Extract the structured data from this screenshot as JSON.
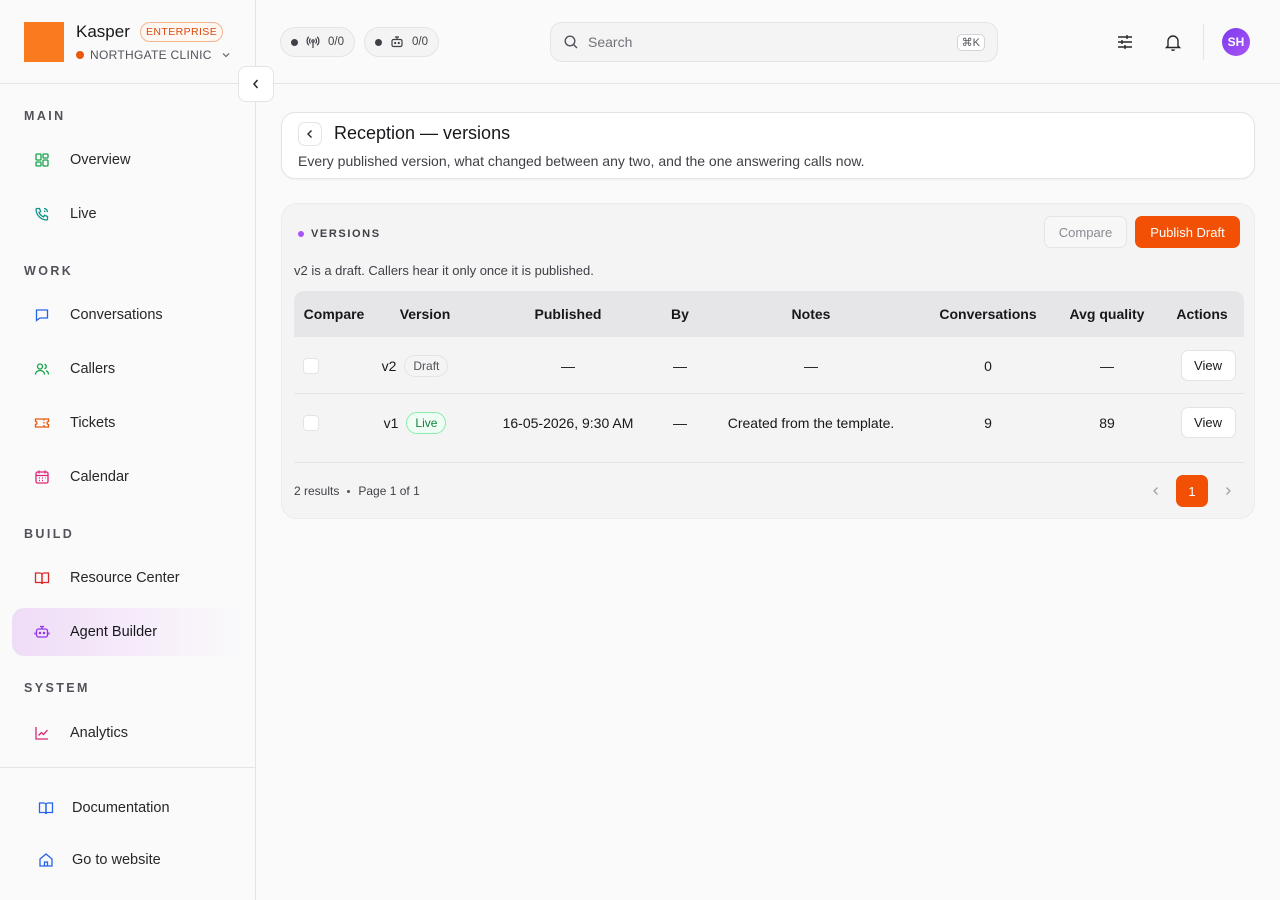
{
  "brand": {
    "name": "Kasper",
    "badge": "ENTERPRISE",
    "org": "NORTHGATE CLINIC"
  },
  "topbar": {
    "pill_calls": "0/0",
    "pill_agents": "0/0",
    "search_placeholder": "Search",
    "search_shortcut": "⌘K",
    "avatar_initials": "SH"
  },
  "sidebar": {
    "sections": {
      "main": "MAIN",
      "work": "WORK",
      "build": "BUILD",
      "system": "SYSTEM"
    },
    "items": {
      "overview": "Overview",
      "live": "Live",
      "conversations": "Conversations",
      "callers": "Callers",
      "tickets": "Tickets",
      "calendar": "Calendar",
      "resource_center": "Resource Center",
      "agent_builder": "Agent Builder",
      "analytics": "Analytics"
    },
    "active": "Agent Builder",
    "bottom": {
      "documentation": "Documentation",
      "website": "Go to website"
    }
  },
  "header": {
    "title": "Reception — versions",
    "subtitle": "Every published version, what changed between any two, and the one answering calls now."
  },
  "versions": {
    "label": "VERSIONS",
    "compare_label": "Compare",
    "publish_label": "Publish Draft",
    "note": "v2 is a draft. Callers hear it only once it is published.",
    "columns": {
      "compare": "Compare",
      "version": "Version",
      "published": "Published",
      "by": "By",
      "notes": "Notes",
      "conversations": "Conversations",
      "quality": "Avg quality",
      "actions": "Actions"
    },
    "rows": [
      {
        "version": "v2",
        "status": "Draft",
        "published": "—",
        "by": "—",
        "notes": "—",
        "conversations": "0",
        "quality": "—",
        "action": "View"
      },
      {
        "version": "v1",
        "status": "Live",
        "published": "16-05-2026, 9:30 AM",
        "by": "—",
        "notes": "Created from the template.",
        "conversations": "9",
        "quality": "89",
        "action": "View"
      }
    ],
    "footer": {
      "results": "2 results",
      "page_info": "Page 1 of 1",
      "current_page": "1"
    }
  },
  "colors": {
    "accent": "#f25005",
    "logo": "#fa7a1e",
    "live_green": "#15803d",
    "active_nav": "#efdcf7"
  }
}
